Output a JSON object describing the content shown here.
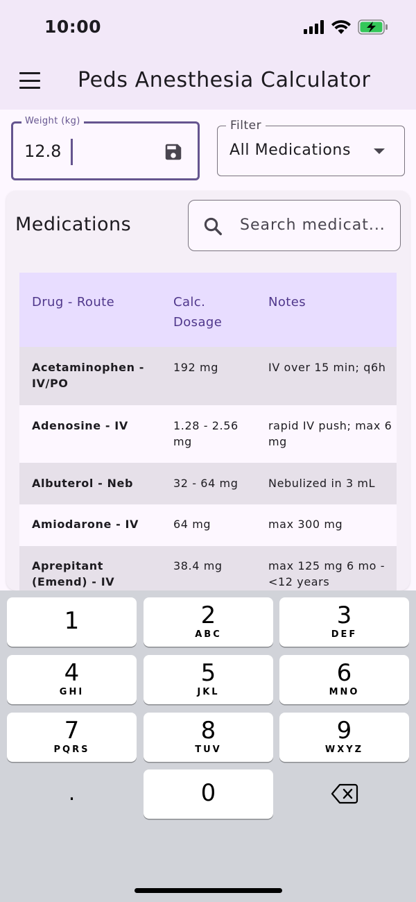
{
  "status_bar": {
    "time": "10:00"
  },
  "app_bar": {
    "title": "Peds Anesthesia Calculator"
  },
  "weight": {
    "label": "Weight (kg)",
    "value": "12.8"
  },
  "filter": {
    "label": "Filter",
    "value": "All Medications"
  },
  "medications": {
    "title": "Medications",
    "search_placeholder": "Search medicat..."
  },
  "table": {
    "headers": [
      "Drug - Route",
      "Calc. Dosage",
      "Notes"
    ],
    "rows": [
      {
        "drug": "Acetaminophen - IV/PO",
        "dosage": "192 mg",
        "notes": "IV over 15 min; q6h"
      },
      {
        "drug": "Adenosine  - IV",
        "dosage": "1.28 - 2.56 mg",
        "notes": "rapid IV push; max 6 mg"
      },
      {
        "drug": "Albuterol - Neb",
        "dosage": "32 - 64 mg",
        "notes": "Nebulized in 3 mL"
      },
      {
        "drug": "Amiodarone - IV",
        "dosage": "64 mg",
        "notes": "max 300 mg"
      },
      {
        "drug": "Aprepitant (Emend) - IV",
        "dosage": "38.4 mg",
        "notes": "max 125 mg 6 mo - <12 years"
      }
    ]
  },
  "keyboard": {
    "keys": [
      {
        "digit": "1",
        "letters": ""
      },
      {
        "digit": "2",
        "letters": "ABC"
      },
      {
        "digit": "3",
        "letters": "DEF"
      },
      {
        "digit": "4",
        "letters": "GHI"
      },
      {
        "digit": "5",
        "letters": "JKL"
      },
      {
        "digit": "6",
        "letters": "MNO"
      },
      {
        "digit": "7",
        "letters": "PQRS"
      },
      {
        "digit": "8",
        "letters": "TUV"
      },
      {
        "digit": "9",
        "letters": "WXYZ"
      },
      {
        "digit": "0",
        "letters": ""
      }
    ],
    "decimal": "."
  },
  "colors": {
    "primary": "#65558f",
    "header_bg": "#e8ddff",
    "app_bar_bg": "#f2e8f8",
    "battery_fill": "#34c759"
  },
  "icons": [
    "menu-icon",
    "save-icon",
    "dropdown-arrow-icon",
    "search-icon",
    "backspace-icon",
    "signal-icon",
    "wifi-icon",
    "battery-charging-icon"
  ]
}
